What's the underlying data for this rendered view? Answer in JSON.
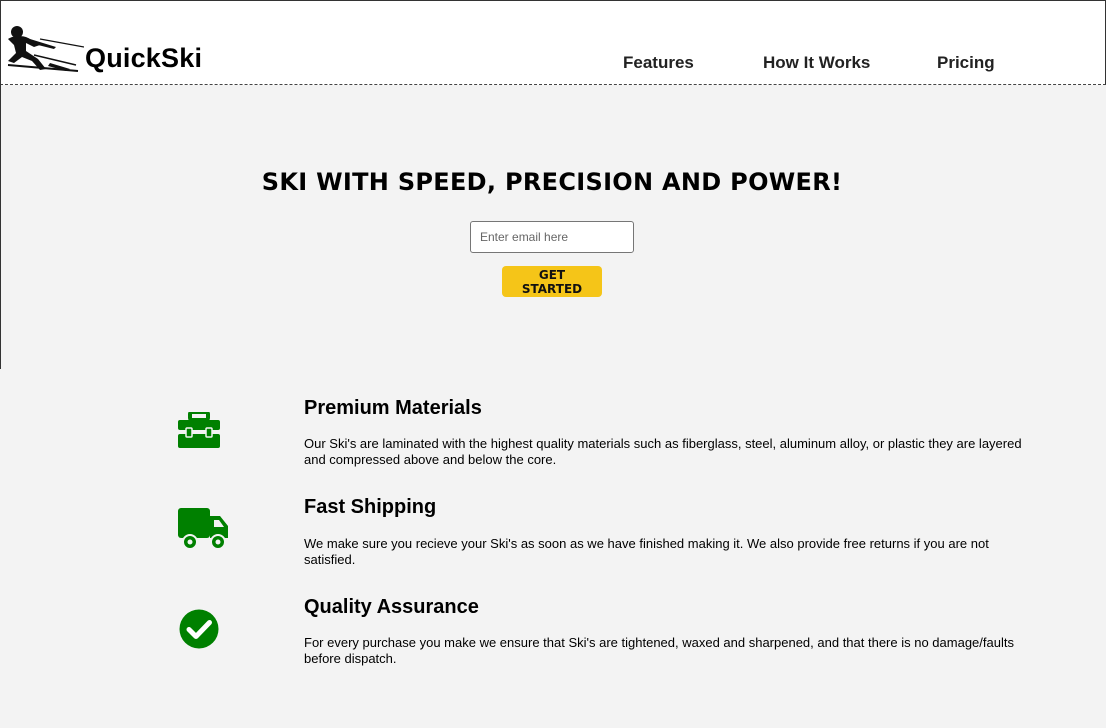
{
  "header": {
    "brand": "QuickSki",
    "nav": [
      "Features",
      "How It Works",
      "Pricing"
    ]
  },
  "hero": {
    "title": "SKI WITH SPEED, PRECISION AND POWER!",
    "email_placeholder": "Enter email here",
    "cta_label": "GET STARTED"
  },
  "features": [
    {
      "icon": "toolbox-icon",
      "title": "Premium Materials",
      "text": "Our Ski's are laminated with the highest quality materials such as fiberglass, steel, aluminum alloy, or plastic they are layered and compressed above and below the core."
    },
    {
      "icon": "truck-icon",
      "title": "Fast Shipping",
      "text": "We make sure you recieve your Ski's as soon as we have finished making it. We also provide free returns if you are not satisfied."
    },
    {
      "icon": "check-circle-icon",
      "title": "Quality Assurance",
      "text": "For every purchase you make we ensure that Ski's are tightened, waxed and sharpened, and that there is no damage/faults before dispatch."
    }
  ],
  "colors": {
    "accent": "#f5c518",
    "icon": "#008000",
    "background": "#f3f3f3"
  }
}
